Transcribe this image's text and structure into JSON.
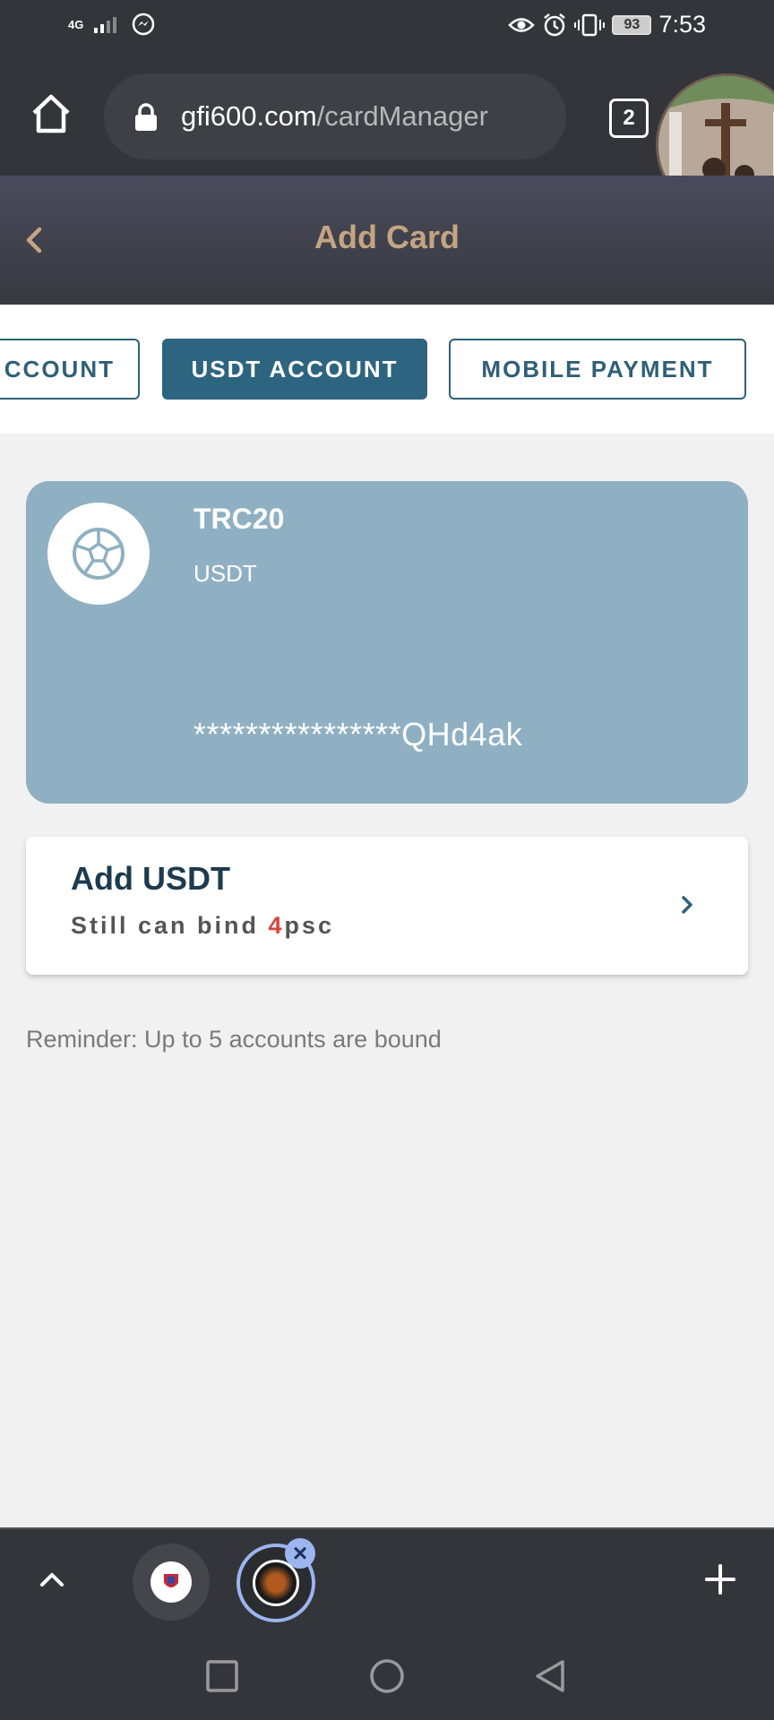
{
  "status_bar": {
    "network": "4G",
    "battery": "93",
    "time": "7:53"
  },
  "browser": {
    "url_domain": "gfi600.com",
    "url_path": "/cardManager",
    "tab_count": "2"
  },
  "header": {
    "title": "Add Card"
  },
  "tabs": [
    {
      "label": "CCOUNT"
    },
    {
      "label": "USDT ACCOUNT"
    },
    {
      "label": "MOBILE PAYMENT"
    }
  ],
  "card": {
    "network": "TRC20",
    "currency": "USDT",
    "address": "****************QHd4ak"
  },
  "add_row": {
    "title": "Add USDT",
    "sub_prefix": "Still can bind ",
    "sub_count": "4",
    "sub_suffix": "psc"
  },
  "reminder": "Reminder: Up to 5 accounts are bound",
  "colors": {
    "active_tab": "#2d6480",
    "card_bg": "#8fb0c2",
    "title": "#c4a581",
    "count_red": "#d6453a"
  }
}
